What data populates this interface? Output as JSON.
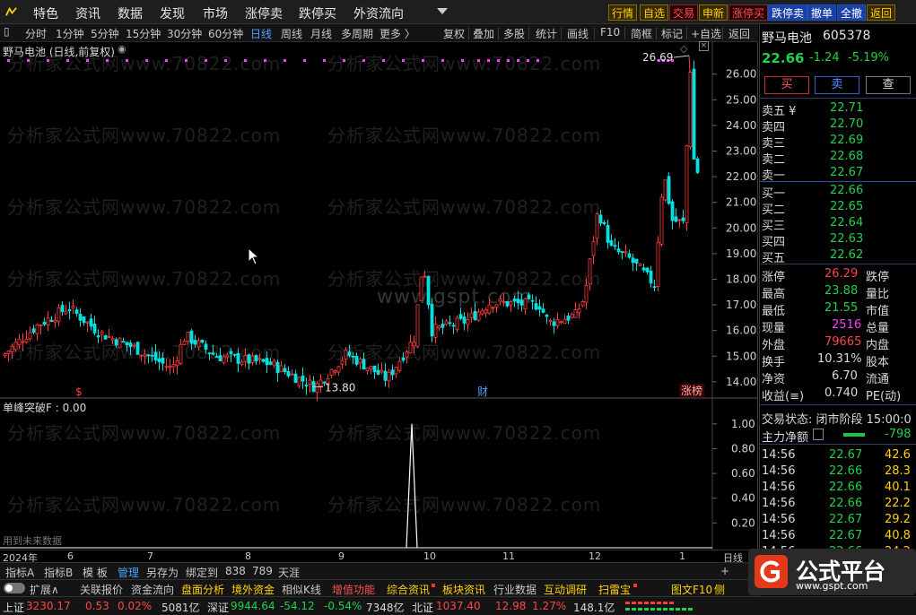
{
  "menubar": {
    "items": [
      "特色",
      "资讯",
      "数据",
      "发现",
      "市场",
      "涨停卖",
      "跌停买",
      "外资流向"
    ],
    "buttons": [
      {
        "label": "行情",
        "style": "y"
      },
      {
        "label": "自选",
        "style": "y"
      },
      {
        "label": "交易",
        "style": "r"
      },
      {
        "label": "申新",
        "style": "y"
      },
      {
        "label": "涨停买",
        "style": "r"
      },
      {
        "label": "跌停卖",
        "style": "b"
      },
      {
        "label": "撤单",
        "style": "b"
      },
      {
        "label": "全撤",
        "style": "b"
      },
      {
        "label": "返回",
        "style": "y"
      }
    ]
  },
  "periodbar": {
    "periods": [
      "分时",
      "1分钟",
      "5分钟",
      "15分钟",
      "30分钟",
      "60分钟",
      "日线",
      "周线",
      "月线",
      "多周期",
      "更多 〉"
    ],
    "selected": "日线",
    "tools": [
      "复权",
      "叠加",
      "多股",
      "统计",
      "画线",
      "F10",
      "简框",
      "标记",
      "+自选",
      "返回"
    ]
  },
  "chart_title": "野马电池 (日线,前复权)",
  "watermark_text": "分析家公式网www.70822.com",
  "watermark_center": "www.gspt.com",
  "indicator_title": "单峰突破F : 0.00",
  "future_note": "用到未来数据",
  "chart_data": [
    {
      "type": "candlestick",
      "series": "野马电池",
      "y_ticks": [
        14.0,
        15.0,
        16.0,
        17.0,
        18.0,
        19.0,
        20.0,
        21.0,
        22.0,
        23.0,
        24.0,
        25.0,
        26.0
      ],
      "ylim": [
        13.4,
        26.9
      ],
      "annotations": [
        {
          "label": "26.69",
          "value": 26.69
        },
        {
          "label": "13.80",
          "value": 13.8
        }
      ],
      "markers": [
        "$",
        "财",
        "涨榜"
      ],
      "x_ticks": [
        "2024年",
        "6",
        "7",
        "8",
        "9",
        "10",
        "11",
        "12",
        "1",
        "日线"
      ]
    },
    {
      "type": "line",
      "series": "单峰突破F",
      "y_ticks": [
        0.2,
        0.4,
        0.6,
        0.8,
        1.0
      ],
      "ylim": [
        0,
        1.1
      ],
      "spike_value": 1.0
    }
  ],
  "tabbar": [
    "指标A",
    "指标B",
    "模 板",
    "管理",
    "另存为",
    "绑定到",
    "838",
    "789",
    "天涯"
  ],
  "tabbar_active": "管理",
  "row2": [
    "扩展∧",
    "关联报价",
    "资金流向",
    "盘面分析",
    "境外资金",
    "相似K线",
    "增值功能",
    "综合资讯",
    "板块资讯",
    "行业数据",
    "互动调研",
    "扫雷宝",
    "图文F10",
    "侧"
  ],
  "right_panel": {
    "name": "野马电池",
    "code": "605378",
    "price": "22.66",
    "change": "-1.24",
    "change_pct": "-5.19%",
    "buttons": [
      "买",
      "卖",
      "查"
    ],
    "asks": [
      {
        "label": "卖五 ¥",
        "price": "22.71"
      },
      {
        "label": "卖四",
        "price": "22.70"
      },
      {
        "label": "卖三",
        "price": "22.69"
      },
      {
        "label": "卖二",
        "price": "22.68"
      },
      {
        "label": "卖一",
        "price": "22.67"
      }
    ],
    "bids": [
      {
        "label": "买一",
        "price": "22.66"
      },
      {
        "label": "买二",
        "price": "22.65"
      },
      {
        "label": "买三",
        "price": "22.64"
      },
      {
        "label": "买四",
        "price": "22.63"
      },
      {
        "label": "买五",
        "price": "22.62"
      }
    ],
    "stats": [
      {
        "k": "涨停",
        "v": "26.29",
        "k2": "跌停",
        "vc": "r"
      },
      {
        "k": "最高",
        "v": "23.88",
        "k2": "量比",
        "vc": "g"
      },
      {
        "k": "最低",
        "v": "21.55",
        "k2": "市值",
        "vc": "g"
      },
      {
        "k": "现量",
        "v": "2516",
        "k2": "总量",
        "vc": "m"
      },
      {
        "k": "外盘",
        "v": "79665",
        "k2": "内盘",
        "vc": "r"
      },
      {
        "k": "换手",
        "v": "10.31%",
        "k2": "股本",
        "vc": "w"
      },
      {
        "k": "净资",
        "v": "6.70",
        "k2": "流通",
        "vc": "w"
      },
      {
        "k": "收益(≡)",
        "v": "0.740",
        "k2": "PE(动)",
        "vc": "w"
      }
    ],
    "trade_state": "交易状态: 闭市阶段 15:00:0",
    "net_flow_label": "主力净额",
    "net_flow_value": "-798",
    "ticks": [
      {
        "t": "14:56",
        "p": "22.67",
        "v": "42.6"
      },
      {
        "t": "14:56",
        "p": "22.66",
        "v": "28.3"
      },
      {
        "t": "14:56",
        "p": "22.66",
        "v": "40.1"
      },
      {
        "t": "14:56",
        "p": "22.66",
        "v": "22.2"
      },
      {
        "t": "14:56",
        "p": "22.67",
        "v": "29.2"
      },
      {
        "t": "14:56",
        "p": "22.67",
        "v": "40.8"
      },
      {
        "t": "14:56",
        "p": "22.66",
        "v": "24.2"
      }
    ]
  },
  "statusbar": {
    "sh_label": "上证",
    "sh_val": "3230.17",
    "sh_chg": "0.53",
    "sh_pct": "0.02%",
    "sh_amt": "5081亿",
    "sz_label": "深证",
    "sz_val": "9944.64",
    "sz_chg": "-54.12",
    "sz_pct": "-0.54%",
    "sz_amt": "7348亿",
    "bz_label": "北证",
    "bz_val": "1037.40",
    "bz_chg": "12.98",
    "bz_pct": "1.27%",
    "bz_amt": "148.1亿"
  },
  "brand": {
    "name": "公式平台",
    "url": "www.gspt.com"
  },
  "colors": {
    "up": "#ff3c3c",
    "down": "#00e0e0",
    "accent": "#4aa0ff",
    "gold": "#ffd200",
    "magenta": "#ff40ff"
  }
}
